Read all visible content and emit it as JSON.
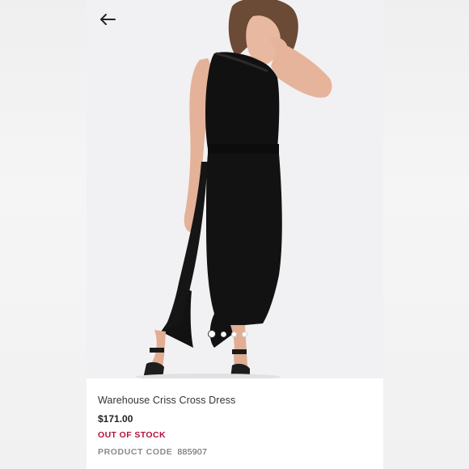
{
  "navigation": {
    "back_icon": "arrow-left-icon"
  },
  "gallery": {
    "image_count": 4,
    "active_index": 0,
    "image_subject": "woman wearing black midi dress"
  },
  "product": {
    "title": "Warehouse Criss Cross Dress",
    "price": "$171.00",
    "stock_status": "OUT OF STOCK",
    "code_label": "PRODUCT CODE",
    "code_value": "885907"
  },
  "colors": {
    "stock_status": "#b0123f",
    "text_primary": "#333333",
    "background": "#f3f3f3"
  }
}
